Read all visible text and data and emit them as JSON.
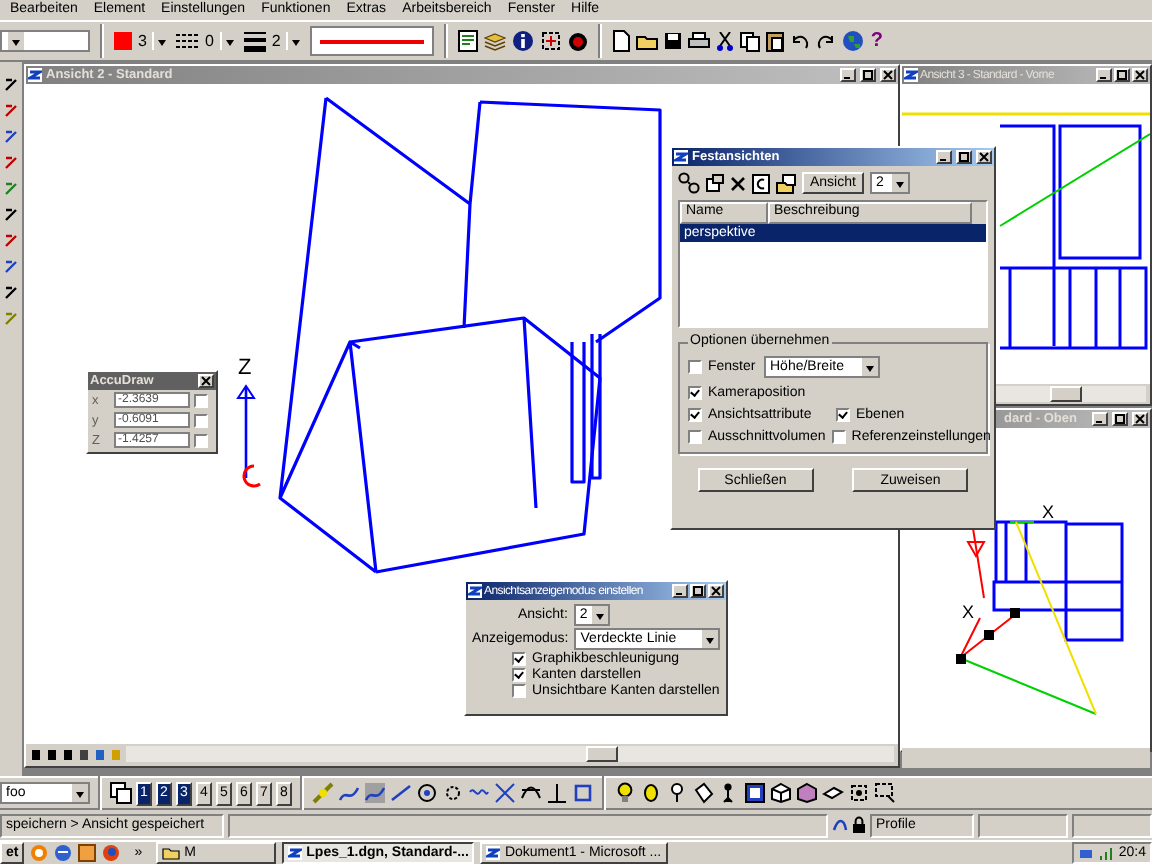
{
  "menu": [
    {
      "label": "Bearbeiten"
    },
    {
      "label": "Element"
    },
    {
      "label": "Einstellungen"
    },
    {
      "label": "Funktionen"
    },
    {
      "label": "Extras"
    },
    {
      "label": "Arbeitsbereich"
    },
    {
      "label": "Fenster"
    },
    {
      "label": "Hilfe"
    }
  ],
  "attributes": {
    "color_number": "3",
    "style_number": "0",
    "weight_number": "2",
    "help": "?"
  },
  "views": [
    {
      "title": "Ansicht 2 - Standard",
      "axis_label": "Z"
    },
    {
      "title": "Ansicht 3 - Standard - Vorne"
    },
    {
      "title": "dard - Oben",
      "marks": [
        "X",
        "X"
      ]
    }
  ],
  "accudraw": {
    "title": "AccuDraw",
    "fields": [
      {
        "label": "x",
        "value": "-2.3639",
        "locked": false
      },
      {
        "label": "y",
        "value": "-0.6091",
        "locked": false
      },
      {
        "label": "Z",
        "value": "-1.4257",
        "locked": false
      }
    ]
  },
  "saved_views": {
    "title": "Festansichten",
    "view_button": "Ansicht",
    "view_number": "2",
    "columns": [
      "Name",
      "Beschreibung"
    ],
    "rows": [
      {
        "name": "perspektive",
        "selected": true
      }
    ],
    "group_title": "Optionen übernehmen",
    "window_option": {
      "label": "Fenster",
      "checked": false,
      "value": "Höhe/Breite"
    },
    "option_rows": [
      [
        {
          "label": "Kameraposition",
          "checked": true
        }
      ],
      [
        {
          "label": "Ansichtsattribute",
          "checked": true
        },
        {
          "label": "Ebenen",
          "checked": true
        }
      ],
      [
        {
          "label": "Ausschnittvolumen",
          "checked": false
        },
        {
          "label": "Referenzeinstellungen",
          "checked": false
        }
      ]
    ],
    "buttons": [
      "Schließen",
      "Zuweisen"
    ]
  },
  "display_mode": {
    "title": "Ansichtsanzeigemodus einstellen",
    "view_label": "Ansicht:",
    "view_number": "2",
    "mode_label": "Anzeigemodus:",
    "mode": "Verdeckte Linie",
    "options": [
      {
        "label": "Graphikbeschleunigung",
        "checked": true
      },
      {
        "label": "Kanten darstellen",
        "checked": true
      },
      {
        "label": "Unsichtbare Kanten darstellen",
        "checked": false
      }
    ]
  },
  "view_toolbar": {
    "dropdown": "foo",
    "view_buttons": [
      {
        "label": "1",
        "selected": true
      },
      {
        "label": "2",
        "selected": true
      },
      {
        "label": "3",
        "selected": true
      },
      {
        "label": "4",
        "selected": false
      },
      {
        "label": "5",
        "selected": false
      },
      {
        "label": "6",
        "selected": false
      },
      {
        "label": "7",
        "selected": false
      },
      {
        "label": "8",
        "selected": false
      }
    ]
  },
  "status_bar": {
    "message": "speichern > Ansicht gespeichert",
    "profile": "Profile"
  },
  "taskbar": {
    "start": "et",
    "more": "»",
    "folder": "M",
    "tasks": [
      {
        "label": "Lpes_1.dgn, Standard-...",
        "selected": true
      },
      {
        "label": "Dokument1 - Microsoft ...",
        "selected": false
      }
    ],
    "clock": "20:4"
  }
}
